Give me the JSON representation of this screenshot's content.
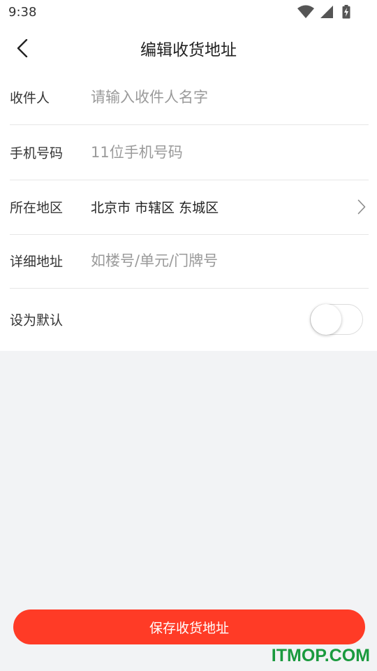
{
  "status_bar": {
    "time": "9:38",
    "icons": [
      "wifi-icon",
      "cellular-signal-icon",
      "battery-charging-icon"
    ]
  },
  "header": {
    "title": "编辑收货地址",
    "back_icon": "chevron-left-icon"
  },
  "form": {
    "recipient": {
      "label": "收件人",
      "placeholder": "请输入收件人名字",
      "value": ""
    },
    "phone": {
      "label": "手机号码",
      "placeholder": "11位手机号码",
      "value": ""
    },
    "region": {
      "label": "所在地区",
      "value": "北京市 市辖区 东城区",
      "icon": "chevron-right-icon"
    },
    "address_detail": {
      "label": "详细地址",
      "placeholder": "如楼号/单元/门牌号",
      "value": ""
    },
    "set_default": {
      "label": "设为默认",
      "enabled": false
    }
  },
  "footer": {
    "save_label": "保存收货地址"
  },
  "watermark": "ITMOP.COM",
  "colors": {
    "accent": "#ff3b26",
    "page_background": "#f2f3f5",
    "card_background": "#ffffff",
    "placeholder": "#9a9a9a",
    "watermark": "#1a9a3e"
  }
}
